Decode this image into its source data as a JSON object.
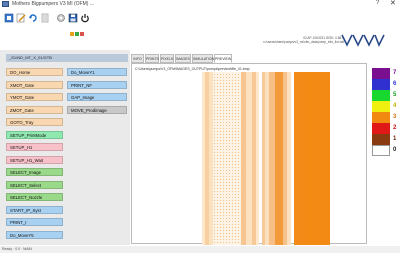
{
  "window": {
    "title": "Mothers Bigpumpers V3 MI (OFM) ...",
    "help": "?",
    "close": "✕"
  },
  "toolbar": {
    "icons": [
      "new-icon",
      "edit-icon",
      "refresh-icon",
      "document-icon",
      "settings-icon",
      "save-icon",
      "power-icon"
    ]
  },
  "status_colors": [
    "#e8a020",
    "#3aa84a",
    "#d9534f"
  ],
  "header": {
    "line1": "ID:AP-1063231 DISK: 0.88.0",
    "line2": "c:/users/share/pumps/v3_mi/ofm_data/pump_info_list.dat",
    "logo_text": "VBVV"
  },
  "left_panel": {
    "header_label": "_S1/ND_MT_X_01/GTB",
    "buttons_col1": [
      {
        "label": "DO_Home",
        "color": "#f9d7b0"
      },
      {
        "label": "XMOT_Gate",
        "color": "#f9d7b0"
      },
      {
        "label": "YMOT_Gate",
        "color": "#f9d7b0"
      },
      {
        "label": "ZMOT_Gate",
        "color": "#f9d7b0"
      },
      {
        "label": "GOTO_Tray",
        "color": "#f9d7b0"
      },
      {
        "label": "SETUP_PrintMode",
        "color": "#8ee8b0"
      },
      {
        "label": "SETUP_H1",
        "color": "#f8c0c8"
      },
      {
        "label": "SETUP_H1_Wait",
        "color": "#f8c0c8"
      },
      {
        "label": "SELECT_Image",
        "color": "#9ad88a"
      },
      {
        "label": "SELECT_Select",
        "color": "#9ad88a"
      },
      {
        "label": "SELECT_Nozzle",
        "color": "#9ad88a"
      },
      {
        "label": "START_IP_Syst",
        "color": "#a8d0f0"
      },
      {
        "label": "PRINT_I",
        "color": "#a8d0f0"
      },
      {
        "label": "Do_MoveY5",
        "color": "#a8d0f0"
      }
    ],
    "buttons_col2": [
      {
        "label": "Do_MoveY1",
        "color": "#a8d0f0"
      },
      {
        "label": "PRINT_NF",
        "color": "#a8d0f0"
      },
      {
        "label": "GAP_Image",
        "color": "#a8d0f0"
      },
      {
        "label": "MOVE_Prodimage",
        "color": "#c8c8c8"
      }
    ]
  },
  "tabs": [
    "INFO",
    "PRINTS",
    "PIXELS",
    "IMAGES",
    "SIMULATION",
    "PREVIEW"
  ],
  "content": {
    "path": "C:\\Users\\pumps\\V3_OFM\\IMAGES_OUTPUT\\pumps\\preview\\file_01.bmp"
  },
  "legend": [
    {
      "label": "7",
      "color": "#7a1090",
      "text_color": "#7a1090"
    },
    {
      "label": "6",
      "color": "#3030d0",
      "text_color": "#3030d0"
    },
    {
      "label": "5",
      "color": "#18d830",
      "text_color": "#18a020"
    },
    {
      "label": "4",
      "color": "#f0f010",
      "text_color": "#c0b000"
    },
    {
      "label": "3",
      "color": "#f08a10",
      "text_color": "#e07010"
    },
    {
      "label": "2",
      "color": "#e01818",
      "text_color": "#d01010"
    },
    {
      "label": "1",
      "color": "#8a3a10",
      "text_color": "#6a2a0a"
    },
    {
      "label": "0",
      "color": "#ffffff",
      "text_color": "#222222"
    }
  ],
  "statusbar": {
    "text": "Ready · 0.0 · MAIN"
  }
}
